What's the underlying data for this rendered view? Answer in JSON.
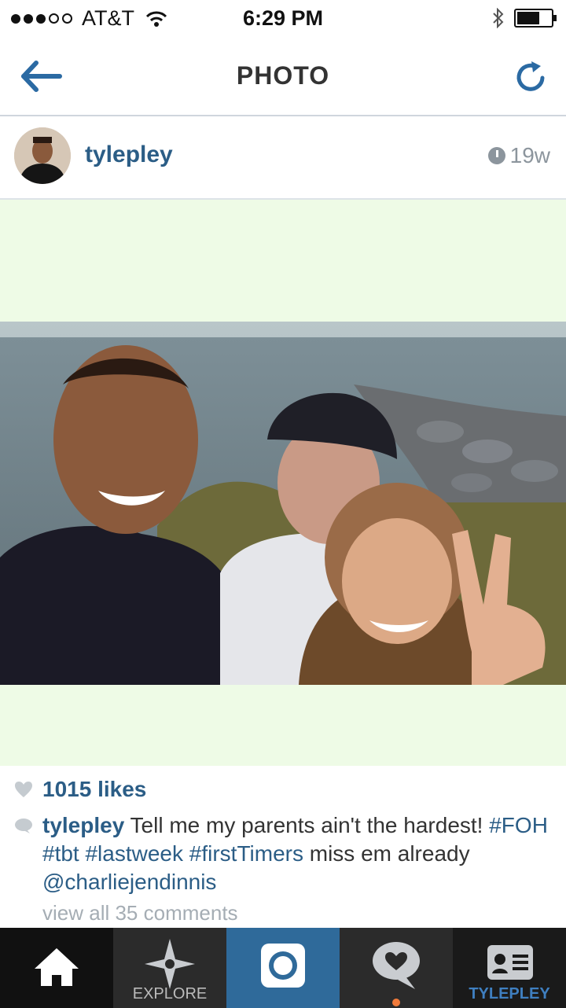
{
  "status_bar": {
    "carrier": "AT&T",
    "time": "6:29 PM"
  },
  "nav": {
    "title": "PHOTO"
  },
  "post": {
    "username": "tylepley",
    "age": "19w",
    "likes": "1015 likes",
    "caption": {
      "username": "tylepley",
      "text": " Tell me my parents ain't the hardest! ",
      "hashtags": [
        "#FOH",
        "#tbt",
        "#lastweek",
        "#firstTimers"
      ],
      "tail": " miss em already ",
      "mention": "@charliejendinnis"
    },
    "view_all": "view all 35 comments"
  },
  "tabs": [
    {
      "label": "",
      "icon": "home-icon"
    },
    {
      "label": "EXPLORE",
      "icon": "compass-star-icon"
    },
    {
      "label": "",
      "icon": "camera-icon"
    },
    {
      "label": "",
      "icon": "heart-speech-icon"
    },
    {
      "label": "TYLEPLEY",
      "icon": "profile-card-icon"
    }
  ],
  "colors": {
    "accent": "#2b5d86",
    "tab_active": "#2f6a9a",
    "photo_bg": "#eefbe6"
  }
}
